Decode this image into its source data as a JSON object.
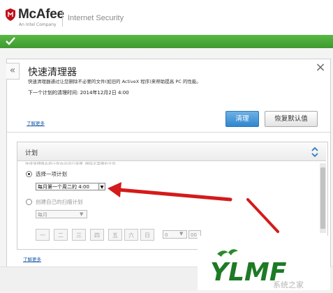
{
  "header": {
    "brand": "McAfee",
    "brand_sub": "An Intel Company",
    "product": "Internet Security"
  },
  "status": {
    "icon": "checkmark-icon",
    "color": "#4aa83a"
  },
  "panel": {
    "back_label": "«",
    "close_label": "×",
    "title": "快速清理器",
    "description": "快速清理器通过让您删除不必要的文件(如旧的 ActiveX 程序)来帮助提高 PC 的性能。",
    "next_schedule": "下一个计划的清理时间: 2014年12月2日 4:00",
    "clean_button": "清理",
    "restore_button": "恢复默认值",
    "learn_more": "了解更多"
  },
  "schedule": {
    "title": "计划",
    "intro": "快速清理器会按计划自动运行清理, 删除不需要的文件",
    "option1_label": "选择一项计划",
    "option1_selected": true,
    "option1_value": "每月第一个周二的 4:00",
    "option2_label": "创建自己的扫描计划",
    "option2_selected": false,
    "frequency_value": "每月",
    "days": [
      "一",
      "二",
      "三",
      "四",
      "五",
      "六",
      "日"
    ],
    "hour_value": "0",
    "minute_value": "00"
  },
  "footer": {
    "learn_more": "了解更多"
  },
  "watermark": {
    "text": "YLMF",
    "subtext": "系统之家"
  },
  "colors": {
    "accent_blue": "#2f86cf",
    "status_green": "#4aa83a",
    "brand_red": "#c0101a",
    "annotation_red": "#d41a1a",
    "watermark_green": "#2a8a2a"
  }
}
